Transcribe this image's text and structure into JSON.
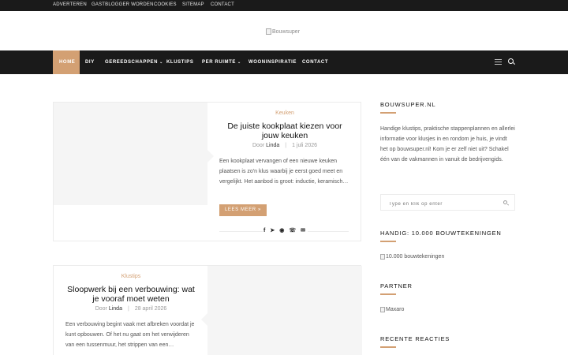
{
  "topbar": {
    "links": [
      "ADVERTEREN",
      "GASTBLOGGER WORDEN",
      "COOKIES",
      "SITEMAP",
      "CONTACT"
    ]
  },
  "logo": {
    "alt": "Bouwsuper"
  },
  "nav": {
    "items": [
      {
        "label": "HOME",
        "active": true
      },
      {
        "label": "DIY"
      },
      {
        "label": "GEREEDSCHAPPEN",
        "dropdown": true
      },
      {
        "label": "KLUSTIPS"
      },
      {
        "label": "PER RUIMTE",
        "dropdown": true
      },
      {
        "label": "WOONINSPIRATIE"
      },
      {
        "label": "CONTACT"
      }
    ]
  },
  "posts": [
    {
      "category": "Keuken",
      "title": "De juiste kookplaat kiezen voor jouw keuken",
      "by": "Door",
      "author": "Linda",
      "date": "1 juli 2026",
      "excerpt": "Een kookplaat vervangen of een nieuwe keuken plaatsen is zo'n klus waarbij je eerst goed meet en vergelijkt. Het aanbod is groot: inductie, keramisch…",
      "read_more": "LEES MEER »"
    },
    {
      "category": "Klustips",
      "title": "Sloopwerk bij een verbouwing: wat je vooraf moet weten",
      "by": "Door",
      "author": "Linda",
      "date": "28 april 2026",
      "excerpt": "Een verbouwing begint vaak met afbreken voordat je kunt opbouwen. Of het nu gaat om het verwijderen van een tussenmuur, het strippen van een…"
    }
  ],
  "sidebar": {
    "about_title": "BOUWSUPER.NL",
    "about_text": "Handige klustips, praktische stappenplannen en allerlei informatie voor klusjes in en rondom je huis, je vindt het op bouwsuper.nl! Kom je er zelf niet uit? Schakel één van de vakmannen in vanuit de bedrijvengids.",
    "search_placeholder": "Type en klik op enter",
    "widget2_title": "HANDIG: 10.000 BOUWTEKENINGEN",
    "widget2_img": "10.000 bouwtekeningen",
    "partner_title": "PARTNER",
    "partner_img": "Maxaro",
    "recent_title": "RECENTE REACTIES"
  },
  "colors": {
    "accent": "#d3a073",
    "dark": "#1a1a1a"
  }
}
